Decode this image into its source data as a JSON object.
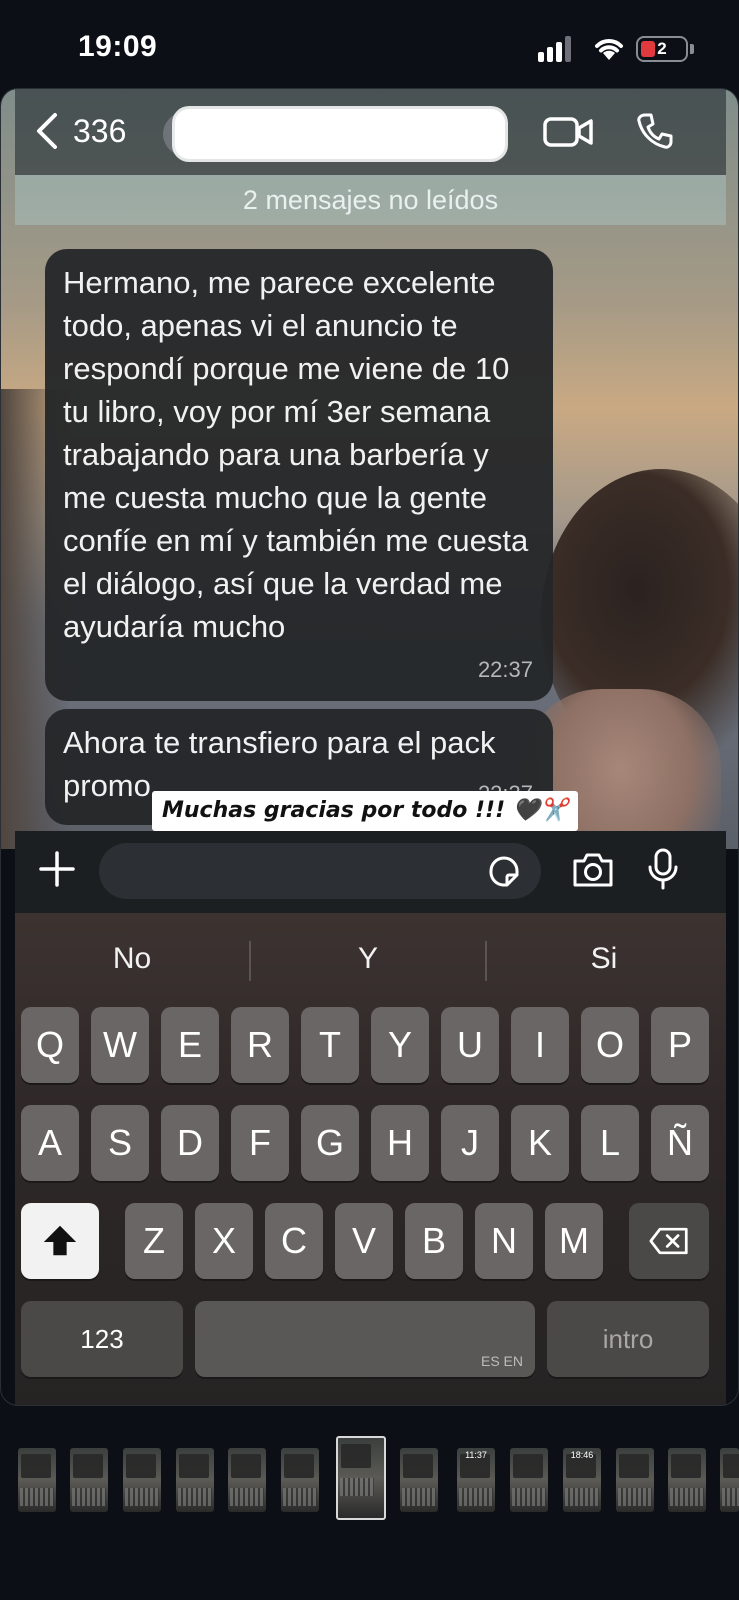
{
  "status_bar": {
    "time": "19:09",
    "battery_level": "2"
  },
  "chat": {
    "back_count": "336",
    "unread_banner": "2 mensajes no leídos",
    "messages": [
      {
        "text": "Hermano, me parece excelente todo, apenas vi el anuncio te respondí porque me viene de 10 tu libro, voy por mí 3er semana trabajando para una barbería y me cuesta mucho que la gente confíe en mí y también me cuesta el diálogo, así que la verdad me ayudaría mucho",
        "time": "22:37"
      },
      {
        "text": "Ahora te transfiero para el pack promo",
        "time": "22:37"
      }
    ]
  },
  "caption": "Muchas gracias por todo !!! 🖤✂️",
  "keyboard": {
    "suggestions": [
      "No",
      "Y",
      "Si"
    ],
    "row1": [
      "Q",
      "W",
      "E",
      "R",
      "T",
      "Y",
      "U",
      "I",
      "O",
      "P"
    ],
    "row2": [
      "A",
      "S",
      "D",
      "F",
      "G",
      "H",
      "J",
      "K",
      "L",
      "Ñ"
    ],
    "row3": [
      "Z",
      "X",
      "C",
      "V",
      "B",
      "N",
      "M"
    ],
    "numbers_key": "123",
    "language_label": "ES EN",
    "return_key": "intro"
  },
  "thumbnails": {
    "times": [
      "11:37",
      "18:46"
    ]
  },
  "colors": {
    "bubble": "#242628",
    "battery_low": "#e0393e",
    "key": "#6b6666"
  }
}
